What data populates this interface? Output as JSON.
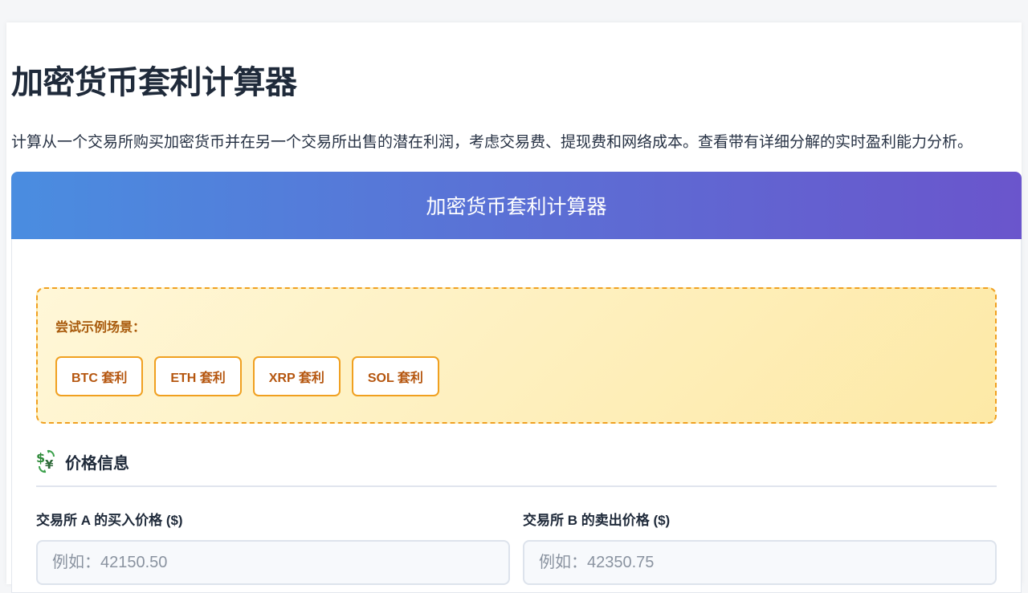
{
  "page": {
    "title": "加密货币套利计算器",
    "description": "计算从一个交易所购买加密货币并在另一个交易所出售的潜在利润，考虑交易费、提现费和网络成本。查看带有详细分解的实时盈利能力分析。"
  },
  "calculator": {
    "header_title": "加密货币套利计算器",
    "examples": {
      "title": "尝试示例场景：",
      "buttons": [
        {
          "label": "BTC 套利"
        },
        {
          "label": "ETH 套利"
        },
        {
          "label": "XRP 套利"
        },
        {
          "label": "SOL 套利"
        }
      ]
    },
    "price_section": {
      "icon": "currency-exchange-icon",
      "title": "价格信息",
      "buy_price": {
        "label": "交易所 A 的买入价格 ($)",
        "value": "",
        "placeholder": "例如：42150.50"
      },
      "sell_price": {
        "label": "交易所 B 的卖出价格 ($)",
        "value": "",
        "placeholder": "例如：42350.75"
      }
    }
  },
  "colors": {
    "header_gradient_start": "#4a8de0",
    "header_gradient_end": "#6a55cc",
    "example_accent": "#f0a020",
    "example_text": "#b5560f"
  }
}
